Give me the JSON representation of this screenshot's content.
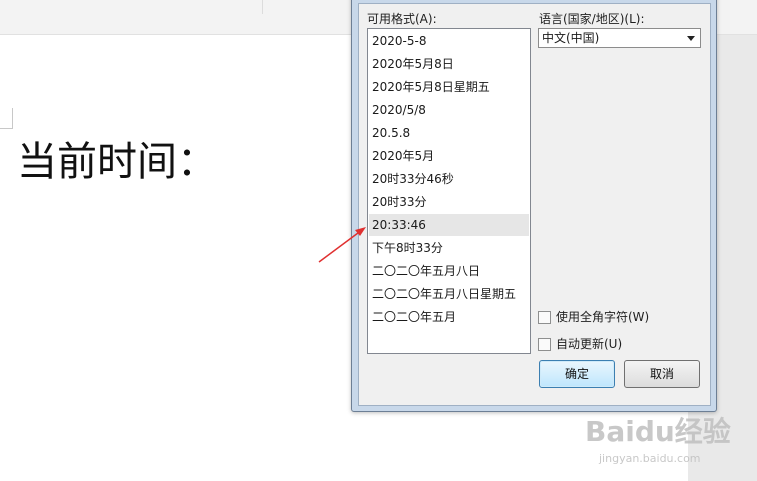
{
  "document": {
    "text": "当前时间："
  },
  "dialog": {
    "formats_label": "可用格式(A):",
    "formats": [
      "2020-5-8",
      "2020年5月8日",
      "2020年5月8日星期五",
      "2020/5/8",
      "20.5.8",
      "2020年5月",
      "20时33分46秒",
      "20时33分",
      "20:33:46",
      "下午8时33分",
      "二〇二〇年五月八日",
      "二〇二〇年五月八日星期五",
      "二〇二〇年五月"
    ],
    "selected_format": "20:33:46",
    "language_label": "语言(国家/地区)(L):",
    "language_value": "中文(中国)",
    "full_width_label": "使用全角字符(W)",
    "auto_update_label": "自动更新(U)",
    "ok_label": "确定",
    "cancel_label": "取消"
  },
  "watermark": {
    "main": "Baidu经验",
    "sub": "jingyan.baidu.com"
  },
  "colors": {
    "arrow": "#e03030",
    "selection": "#e6e6e6",
    "dialog_frame": "#c8d8ea"
  }
}
